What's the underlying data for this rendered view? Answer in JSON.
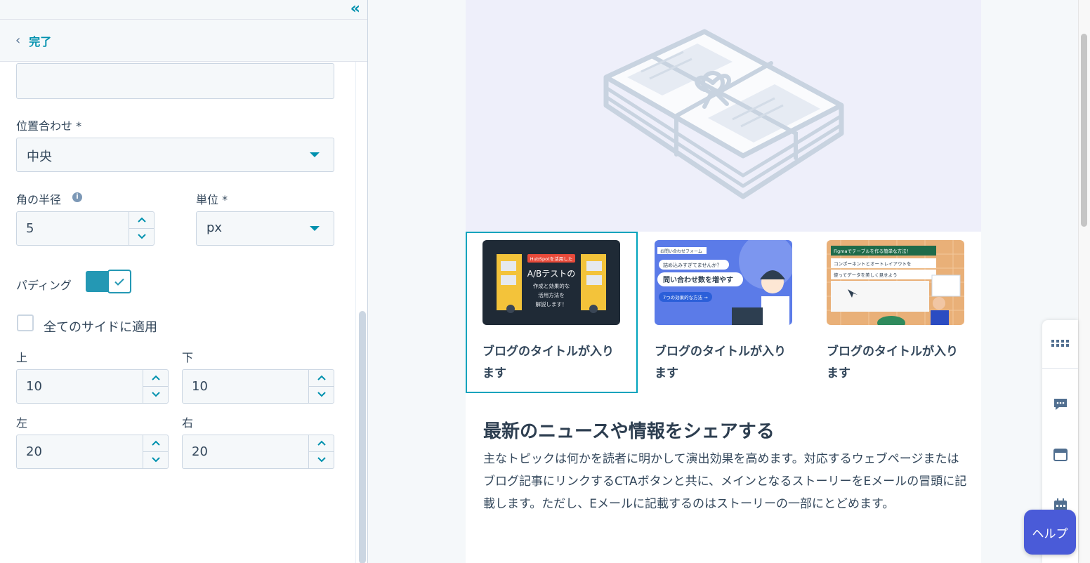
{
  "panel": {
    "done_label": "完了",
    "alignment": {
      "label": "位置合わせ *",
      "value": "中央"
    },
    "corner_radius": {
      "label": "角の半径",
      "value": "5"
    },
    "unit": {
      "label": "単位 *",
      "value": "px"
    },
    "padding": {
      "label": "パディング",
      "enabled": true
    },
    "apply_all_sides": {
      "label": "全てのサイドに適用",
      "checked": false
    },
    "sides": {
      "top": {
        "label": "上",
        "value": "10"
      },
      "bottom": {
        "label": "下",
        "value": "10"
      },
      "left": {
        "label": "左",
        "value": "20"
      },
      "right": {
        "label": "右",
        "value": "20"
      }
    }
  },
  "preview": {
    "posts": [
      {
        "title": "ブログのタイトルが入ります",
        "thumb_badge": "HubSpotを活用した",
        "thumb_headline": "A/Bテストの",
        "thumb_lines": [
          "作成と効果的な",
          "活用方法を",
          "解説します！"
        ]
      },
      {
        "title": "ブログのタイトルが入ります",
        "thumb_small": "お問い合わせフォーム",
        "thumb_question": "詰め込みすぎてませんか？",
        "thumb_main": "問い合わせ数を増やす",
        "thumb_pill": "7つの効果的な方法 →"
      },
      {
        "title": "ブログのタイトルが入ります",
        "thumb_header": "Figmaでテーブルを作る簡単な方法！",
        "thumb_line1": "コンポーネントとオートレイアウトを",
        "thumb_line2": "使ってデータを美しく見せよう"
      }
    ],
    "section_heading": "最新のニュースや情報をシェアする",
    "section_body": "主なトピックは何かを読者に明かして演出効果を高めます。対応するウェブページまたはブログ記事にリンクするCTAボタンと共に、メインとなるストーリーをEメールの冒頭に記載します。ただし、Eメールに記載するのはストーリーの一部にとどめます。"
  },
  "help_label": "ヘルプ",
  "colors": {
    "accent": "#0091ae",
    "toggle": "#2498b4",
    "help": "#4a5bd8"
  }
}
